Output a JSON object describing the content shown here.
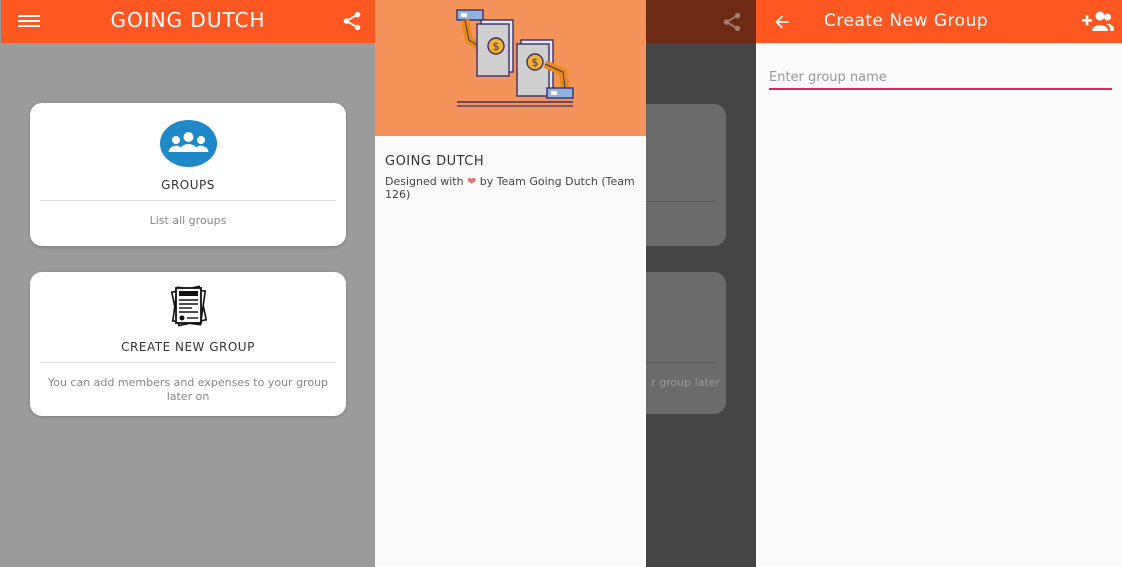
{
  "home": {
    "app_title": "GOING DUTCH",
    "menu_icon": "hamburger-menu-icon",
    "share_icon": "share-icon",
    "cards": [
      {
        "icon": "groups-icon",
        "title": "GROUPS",
        "subtitle": "List all groups"
      },
      {
        "icon": "invoice-icon",
        "title": "CREATE NEW GROUP",
        "subtitle": "You can add members and expenses to your group later on"
      }
    ]
  },
  "drawer": {
    "title": "GOING DUTCH",
    "credit_prefix": "Designed with",
    "credit_heart": "❤",
    "credit_suffix": "by Team Going Dutch (Team 126)",
    "background_hint": "r group later"
  },
  "create_group": {
    "title": "Create New Group",
    "back_icon": "back-arrow-icon",
    "action_icon": "add-person-icon",
    "input_placeholder": "Enter group name",
    "input_value": ""
  },
  "colors": {
    "primary": "#ff5722",
    "drawer_header": "#f4945a",
    "groups_icon_bg": "#1e88c8",
    "input_underline": "#e91e63"
  }
}
